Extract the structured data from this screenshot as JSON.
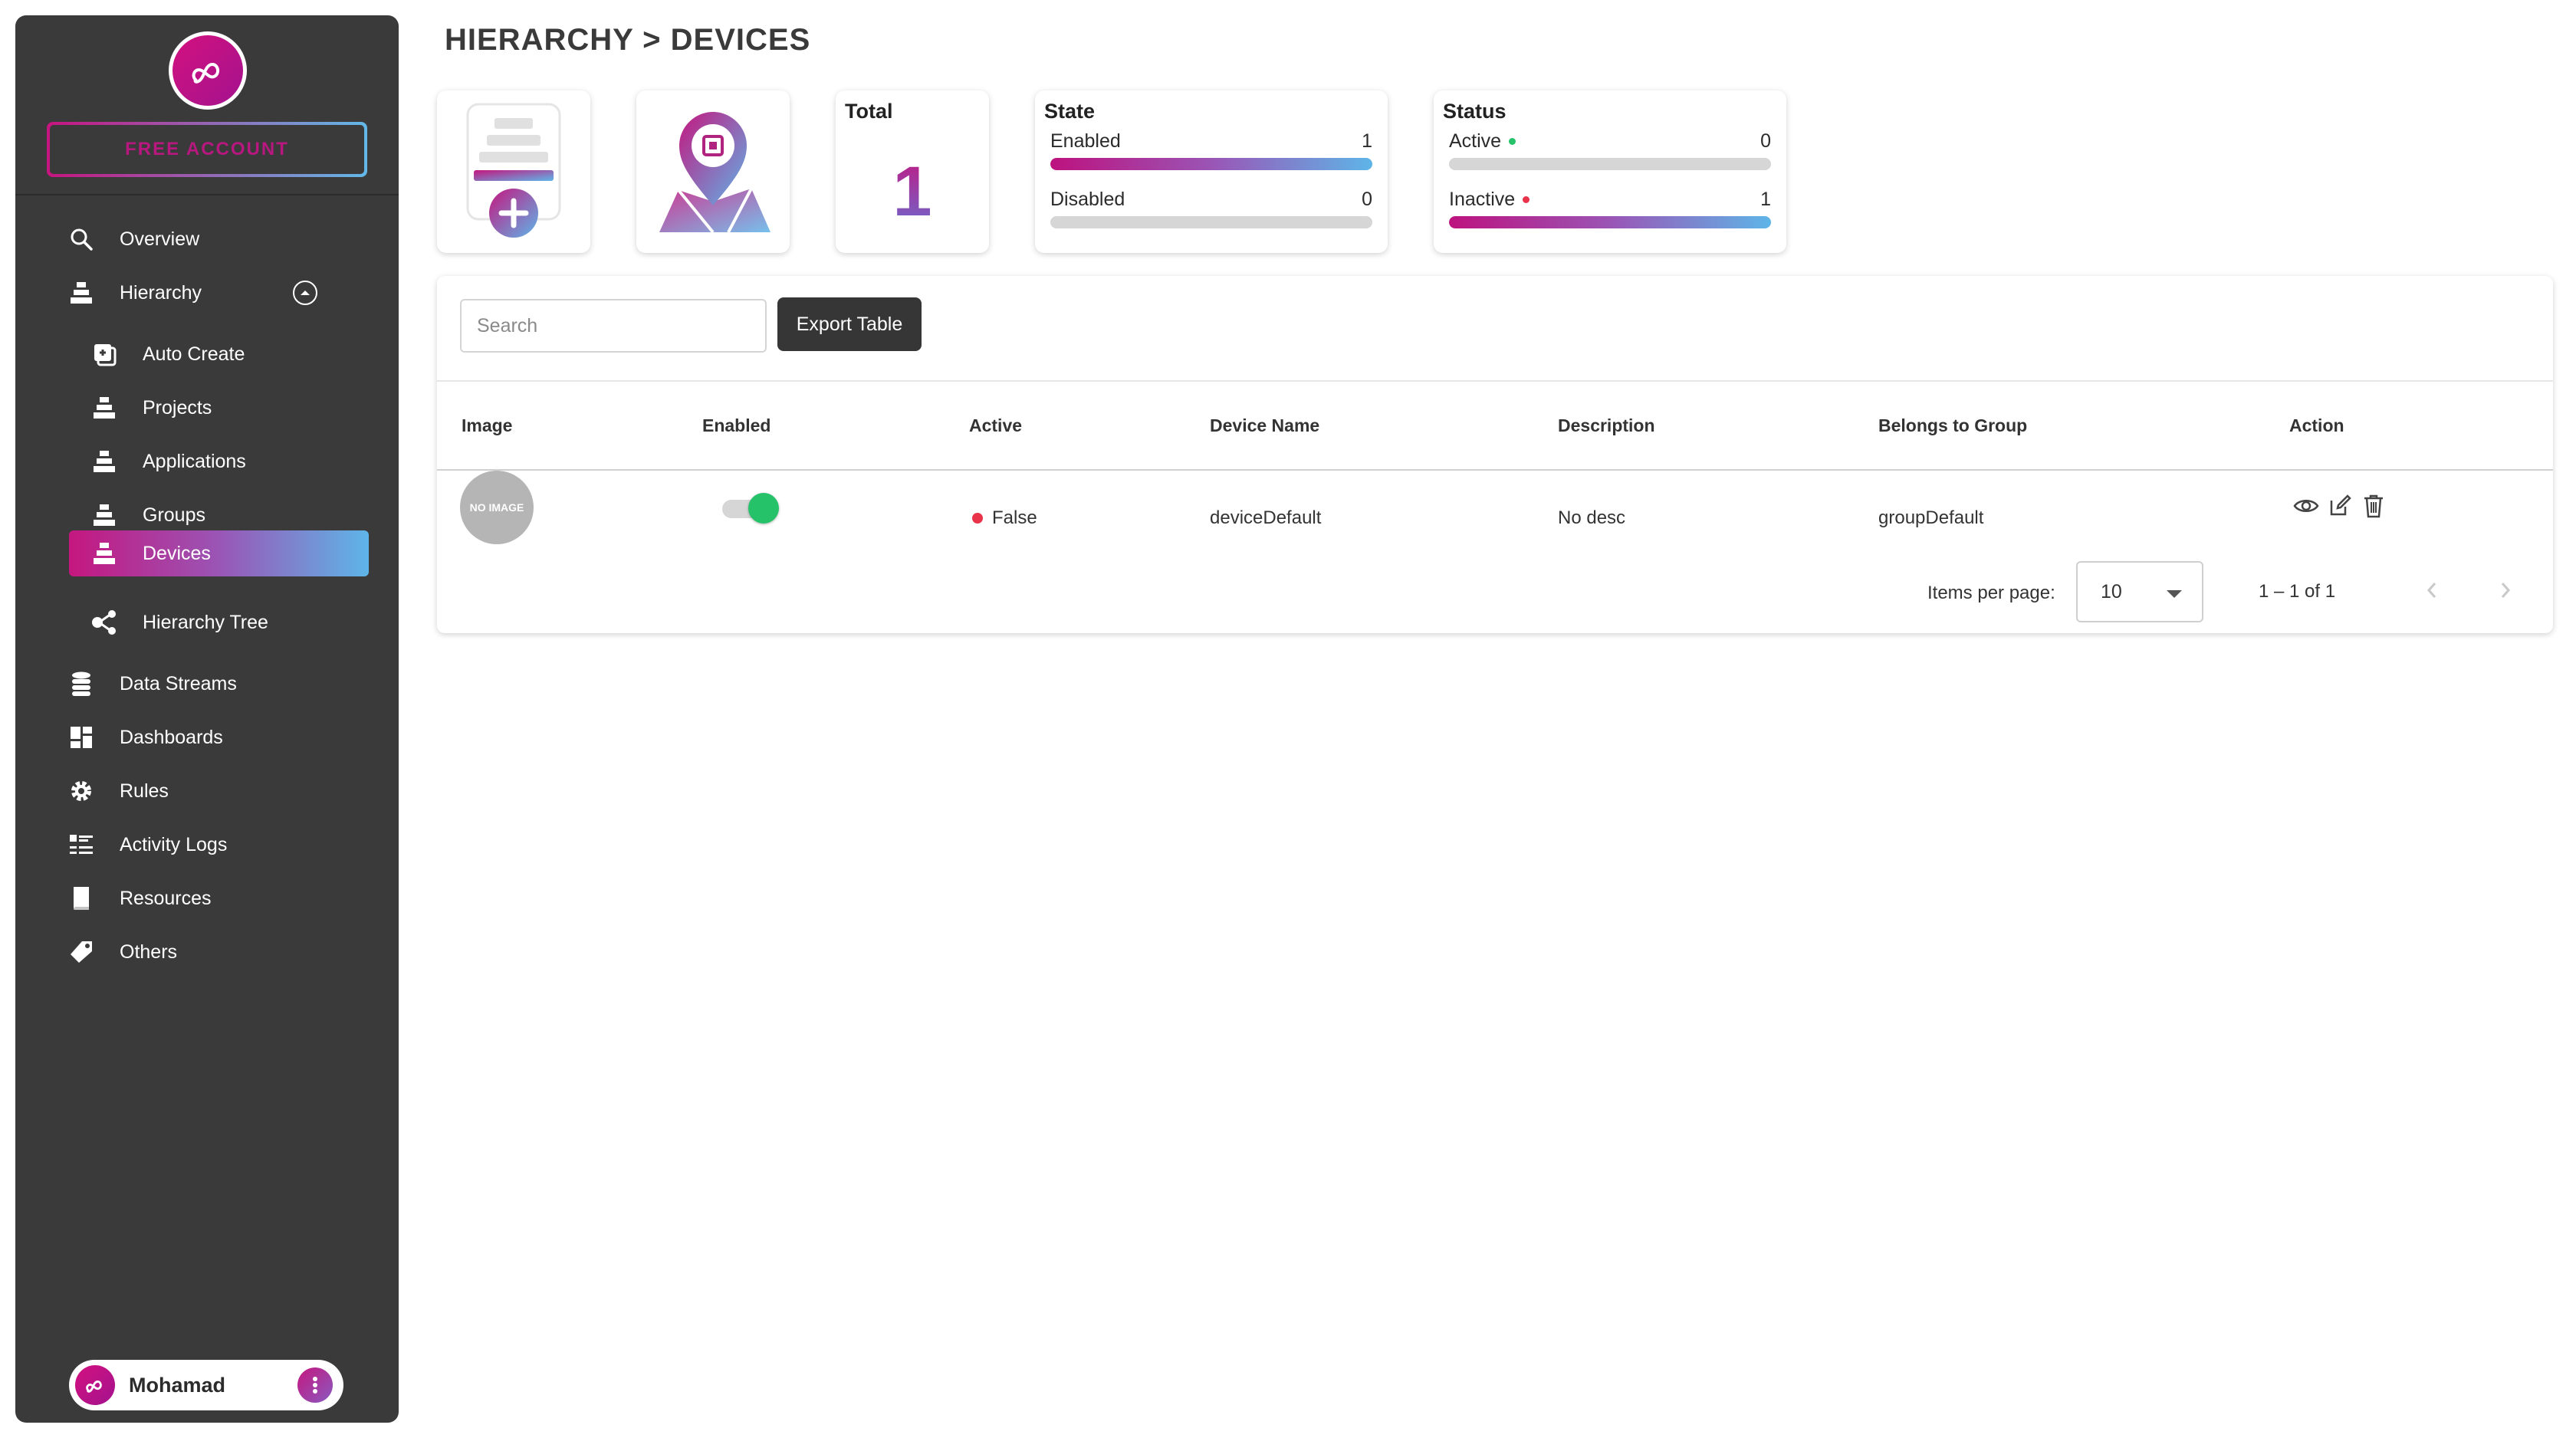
{
  "app": {
    "account_label": "FREE ACCOUNT",
    "logo_icon": "infinity-logo-icon",
    "brand_gradient": [
      "#c4177f",
      "#5eb5e8"
    ],
    "sidebar_bg": "#3a3a3a"
  },
  "sidebar": {
    "items": [
      {
        "label": "Overview",
        "icon": "search-icon"
      },
      {
        "label": "Hierarchy",
        "icon": "hierarchy-icon",
        "expanded": true
      },
      {
        "label": "Auto Create",
        "icon": "auto-create-icon",
        "sub": true
      },
      {
        "label": "Projects",
        "icon": "hierarchy-icon",
        "sub": true
      },
      {
        "label": "Applications",
        "icon": "hierarchy-icon",
        "sub": true
      },
      {
        "label": "Groups",
        "icon": "hierarchy-icon",
        "sub": true
      },
      {
        "label": "Devices",
        "icon": "hierarchy-icon",
        "sub": true,
        "active": true
      },
      {
        "label": "Hierarchy Tree",
        "icon": "tree-icon",
        "sub": true
      },
      {
        "label": "Data Streams",
        "icon": "database-icon"
      },
      {
        "label": "Dashboards",
        "icon": "dashboard-icon"
      },
      {
        "label": "Rules",
        "icon": "gear-icon"
      },
      {
        "label": "Activity Logs",
        "icon": "list-icon"
      },
      {
        "label": "Resources",
        "icon": "book-icon"
      },
      {
        "label": "Others",
        "icon": "tag-icon"
      }
    ],
    "user": {
      "name": "Mohamad",
      "menu_icon": "more-vertical-icon"
    }
  },
  "header": {
    "breadcrumb": "HIERARCHY > DEVICES"
  },
  "cards": {
    "add_icon": "add-device-icon",
    "map_icon": "device-map-icon",
    "total": {
      "title": "Total",
      "value": "1"
    },
    "state": {
      "title": "State",
      "rows": [
        {
          "label": "Enabled",
          "value": "1",
          "fraction": 1.0
        },
        {
          "label": "Disabled",
          "value": "0",
          "fraction": 0.0
        }
      ]
    },
    "status": {
      "title": "Status",
      "rows": [
        {
          "label": "Active",
          "value": "0",
          "fraction": 0.0,
          "dot_color": "#25c26a"
        },
        {
          "label": "Inactive",
          "value": "1",
          "fraction": 1.0,
          "dot_color": "#e8334a"
        }
      ]
    }
  },
  "toolbar": {
    "search_placeholder": "Search",
    "export_label": "Export Table"
  },
  "table": {
    "columns": [
      "Image",
      "Enabled",
      "Active",
      "Device Name",
      "Description",
      "Belongs to Group",
      "Action"
    ],
    "rows": [
      {
        "image_text": "NO IMAGE",
        "enabled": true,
        "active": "False",
        "active_color": "#e8334a",
        "device_name": "deviceDefault",
        "description": "No desc",
        "group": "groupDefault",
        "actions": [
          "eye-icon",
          "edit-icon",
          "trash-icon"
        ]
      }
    ]
  },
  "pagination": {
    "items_per_page_label": "Items per page:",
    "items_per_page": "10",
    "range": "1 – 1 of 1",
    "prev_icon": "chevron-left-icon",
    "next_icon": "chevron-right-icon"
  }
}
